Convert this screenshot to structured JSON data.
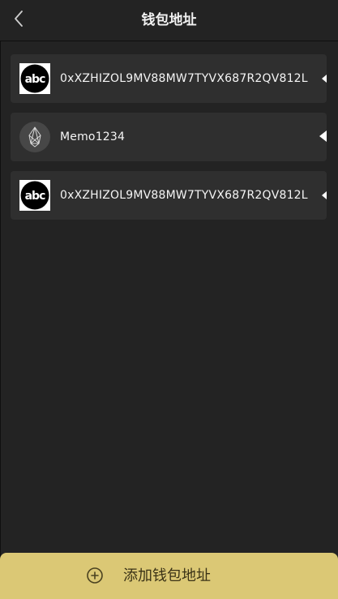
{
  "header": {
    "title": "钱包地址",
    "back_icon": "chevron-left-icon"
  },
  "addresses": [
    {
      "label": "0xXZHIZOL9MV88MW7TYVX687R2QV812L",
      "icon": "abc-logo-icon"
    },
    {
      "label": "Memo1234",
      "icon": "eos-logo-icon"
    },
    {
      "label": "0xXZHIZOL9MV88MW7TYVX687R2QV812L",
      "icon": "abc-logo-icon"
    }
  ],
  "bottom": {
    "add_label": "添加钱包地址",
    "add_icon": "plus-circle-icon"
  },
  "colors": {
    "background": "#232323",
    "card": "#2f2f2f",
    "accent": "#dbc875"
  }
}
